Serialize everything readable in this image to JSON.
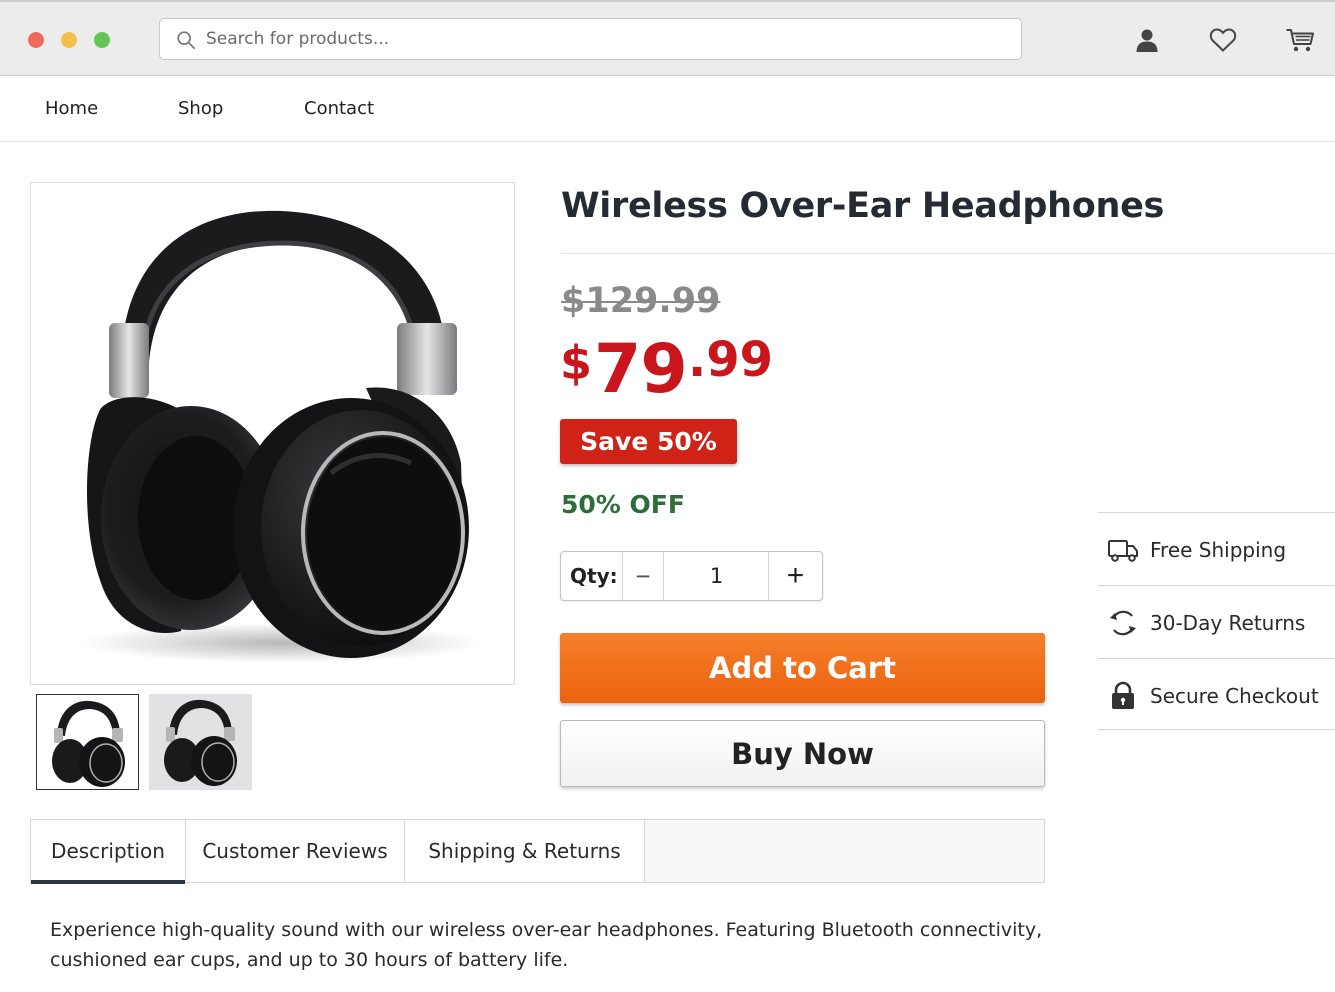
{
  "window": {
    "controls": [
      "close",
      "minimize",
      "maximize"
    ]
  },
  "search": {
    "placeholder": "Search for products..."
  },
  "header_icons": [
    "account-icon",
    "wishlist-heart-icon",
    "cart-icon"
  ],
  "nav": {
    "items": [
      {
        "label": "Home"
      },
      {
        "label": "Shop"
      },
      {
        "label": "Contact"
      }
    ]
  },
  "product": {
    "title": "Wireless Over-Ear Headphones",
    "original_price": "$129.99",
    "price": {
      "currency": "$",
      "whole": "79",
      "decimal": ".99"
    },
    "save_badge": "Save 50%",
    "discount_text": "50% OFF",
    "image_alt": "headphones",
    "thumbnails": 2,
    "selected_thumbnail": 1
  },
  "quantity": {
    "label": "Qty:",
    "value": "1",
    "minus": "−",
    "plus": "+"
  },
  "actions": {
    "add_to_cart": "Add to Cart",
    "buy_now": "Buy Now"
  },
  "features": [
    {
      "icon": "truck-icon",
      "label": "Free Shipping"
    },
    {
      "icon": "refresh-icon",
      "label": "30-Day Returns"
    },
    {
      "icon": "lock-icon",
      "label": "Secure Checkout"
    }
  ],
  "tabs": [
    {
      "label": "Description",
      "active": true
    },
    {
      "label": "Customer Reviews",
      "active": false
    },
    {
      "label": "Shipping & Returns",
      "active": false
    }
  ],
  "description": "Experience high-quality sound with our wireless over-ear headphones. Featuring Bluetooth connectivity, cushioned ear cups, and up to 30 hours of battery life.",
  "colors": {
    "price_red": "#c8161c",
    "badge_red": "#cf2317",
    "off_green": "#2f6e3b",
    "cart_orange": "#f57f2a"
  }
}
